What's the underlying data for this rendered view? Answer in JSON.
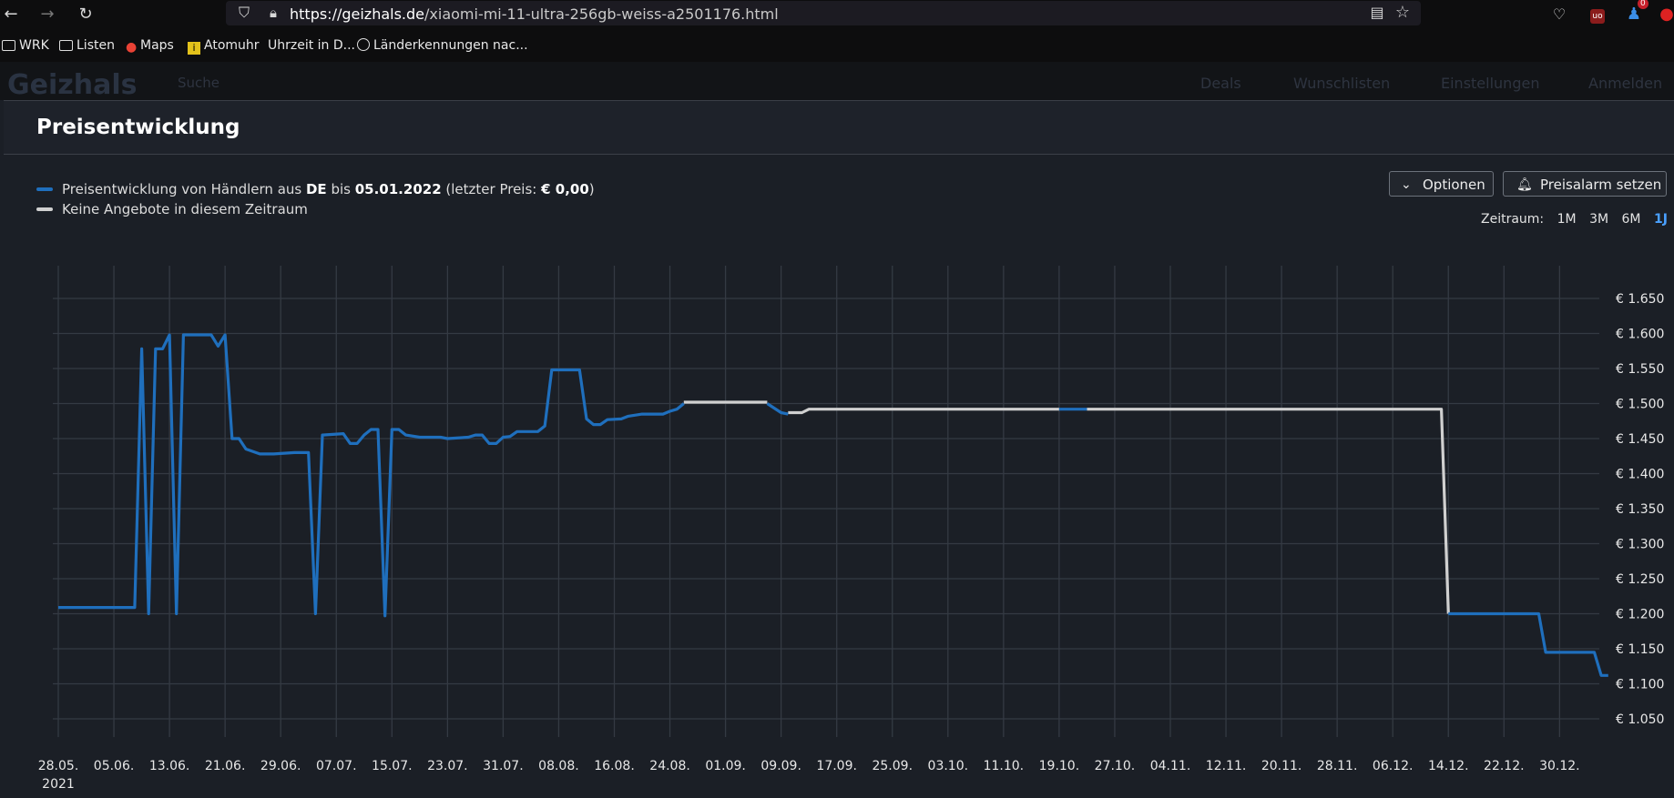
{
  "browser": {
    "url_host": "https://geizhals.de",
    "url_path": "/xiaomi-mi-11-ultra-256gb-weiss-a2501176.html",
    "bookmarks": [
      {
        "label": "WRK",
        "icon": "folder-icon"
      },
      {
        "label": "Listen",
        "icon": "folder-icon"
      },
      {
        "label": "Maps",
        "icon": "maps-pin-icon"
      },
      {
        "label": "Atomuhr",
        "icon": "info-badge-icon"
      },
      {
        "label": "Uhrzeit in D...",
        "icon": ""
      },
      {
        "label": "Länderkennungen nac...",
        "icon": "globe-icon"
      }
    ],
    "extension_badge": "0"
  },
  "background_page": {
    "logo": "Geizhals",
    "search_placeholder": "Suche",
    "nav": [
      "Deals",
      "Wunschlisten",
      "Einstellungen",
      "Anmelden"
    ]
  },
  "modal": {
    "title": "Preisentwicklung",
    "legend": {
      "row1_prefix": "Preisentwicklung von Händlern aus ",
      "row1_country": "DE",
      "row1_mid": " bis ",
      "row1_date": "05.01.2022",
      "row1_price_prefix": " (letzter Preis: ",
      "row1_price": "€ 0,00",
      "row1_suffix": ")",
      "row2": "Keine Angebote in diesem Zeitraum",
      "color_prices": "#1f6fbd",
      "color_no_offers": "#d0d0d0"
    },
    "buttons": {
      "options_label": "Optionen",
      "alarm_label": "Preisalarm setzen"
    },
    "period": {
      "label": "Zeitraum:",
      "options": [
        "1M",
        "3M",
        "6M",
        "1J"
      ],
      "active": "1J"
    }
  },
  "chart_data": {
    "type": "line",
    "title": "Preisentwicklung",
    "x_ticks": [
      "28.05.",
      "05.06.",
      "13.06.",
      "21.06.",
      "29.06.",
      "07.07.",
      "15.07.",
      "23.07.",
      "31.07.",
      "08.08.",
      "16.08.",
      "24.08.",
      "01.09.",
      "09.09.",
      "17.09.",
      "25.09.",
      "03.10.",
      "11.10.",
      "19.10.",
      "27.10.",
      "04.11.",
      "12.11.",
      "20.11.",
      "28.11.",
      "06.12.",
      "14.12.",
      "22.12.",
      "30.12."
    ],
    "x_year_label": "2021",
    "y_ticks": [
      "€ 1.050",
      "€ 1.100",
      "€ 1.150",
      "€ 1.200",
      "€ 1.250",
      "€ 1.300",
      "€ 1.350",
      "€ 1.400",
      "€ 1.450",
      "€ 1.500",
      "€ 1.550",
      "€ 1.600",
      "€ 1.650"
    ],
    "ylim": [
      1030,
      1680
    ],
    "grid": true,
    "y_axis_side": "right",
    "series": [
      {
        "name": "Preisentwicklung von Händlern aus DE",
        "color": "#1f6fbd",
        "segments": [
          [
            [
              "2021-05-28",
              1209
            ],
            [
              "2021-06-08",
              1209
            ],
            [
              "2021-06-09",
              1578
            ],
            [
              "2021-06-10",
              1200
            ],
            [
              "2021-06-11",
              1578
            ],
            [
              "2021-06-12",
              1578
            ],
            [
              "2021-06-13",
              1598
            ],
            [
              "2021-06-14",
              1200
            ],
            [
              "2021-06-15",
              1598
            ],
            [
              "2021-06-19",
              1598
            ],
            [
              "2021-06-20",
              1582
            ],
            [
              "2021-06-21",
              1598
            ],
            [
              "2021-06-22",
              1450
            ],
            [
              "2021-06-23",
              1450
            ],
            [
              "2021-06-24",
              1435
            ],
            [
              "2021-06-26",
              1428
            ],
            [
              "2021-06-28",
              1428
            ],
            [
              "2021-07-01",
              1430
            ],
            [
              "2021-07-03",
              1430
            ],
            [
              "2021-07-04",
              1200
            ],
            [
              "2021-07-05",
              1455
            ],
            [
              "2021-07-08",
              1457
            ],
            [
              "2021-07-09",
              1443
            ],
            [
              "2021-07-10",
              1443
            ],
            [
              "2021-07-11",
              1455
            ],
            [
              "2021-07-12",
              1463
            ],
            [
              "2021-07-13",
              1463
            ],
            [
              "2021-07-14",
              1197
            ],
            [
              "2021-07-15",
              1463
            ],
            [
              "2021-07-16",
              1463
            ],
            [
              "2021-07-17",
              1455
            ],
            [
              "2021-07-19",
              1452
            ],
            [
              "2021-07-22",
              1452
            ],
            [
              "2021-07-23",
              1450
            ],
            [
              "2021-07-26",
              1452
            ],
            [
              "2021-07-27",
              1455
            ],
            [
              "2021-07-28",
              1455
            ],
            [
              "2021-07-29",
              1443
            ],
            [
              "2021-07-30",
              1443
            ],
            [
              "2021-07-31",
              1452
            ],
            [
              "2021-08-01",
              1453
            ],
            [
              "2021-08-02",
              1460
            ],
            [
              "2021-08-05",
              1460
            ],
            [
              "2021-08-06",
              1468
            ],
            [
              "2021-08-07",
              1548
            ],
            [
              "2021-08-10",
              1548
            ],
            [
              "2021-08-11",
              1548
            ],
            [
              "2021-08-12",
              1478
            ],
            [
              "2021-08-13",
              1470
            ],
            [
              "2021-08-14",
              1470
            ],
            [
              "2021-08-15",
              1477
            ],
            [
              "2021-08-17",
              1478
            ],
            [
              "2021-08-18",
              1482
            ],
            [
              "2021-08-20",
              1485
            ],
            [
              "2021-08-23",
              1485
            ],
            [
              "2021-08-24",
              1489
            ],
            [
              "2021-08-25",
              1492
            ],
            [
              "2021-08-26",
              1500
            ]
          ],
          [
            [
              "2021-09-07",
              1500
            ],
            [
              "2021-09-09",
              1487
            ],
            [
              "2021-09-10",
              1485
            ]
          ],
          [
            [
              "2021-10-19",
              1492
            ],
            [
              "2021-10-23",
              1492
            ]
          ],
          [
            [
              "2021-12-14",
              1200
            ],
            [
              "2021-12-27",
              1200
            ],
            [
              "2021-12-28",
              1145
            ],
            [
              "2022-01-04",
              1145
            ],
            [
              "2022-01-05",
              1112
            ],
            [
              "2022-01-06",
              1112
            ]
          ]
        ]
      },
      {
        "name": "Keine Angebote in diesem Zeitraum",
        "color": "#d0d0d0",
        "segments": [
          [
            [
              "2021-08-26",
              1502
            ],
            [
              "2021-09-07",
              1502
            ]
          ],
          [
            [
              "2021-09-10",
              1487
            ],
            [
              "2021-09-12",
              1487
            ],
            [
              "2021-09-13",
              1492
            ],
            [
              "2021-10-19",
              1492
            ]
          ],
          [
            [
              "2021-10-23",
              1492
            ],
            [
              "2021-12-12",
              1492
            ],
            [
              "2021-12-13",
              1492
            ],
            [
              "2021-12-14",
              1200
            ]
          ]
        ]
      }
    ]
  }
}
